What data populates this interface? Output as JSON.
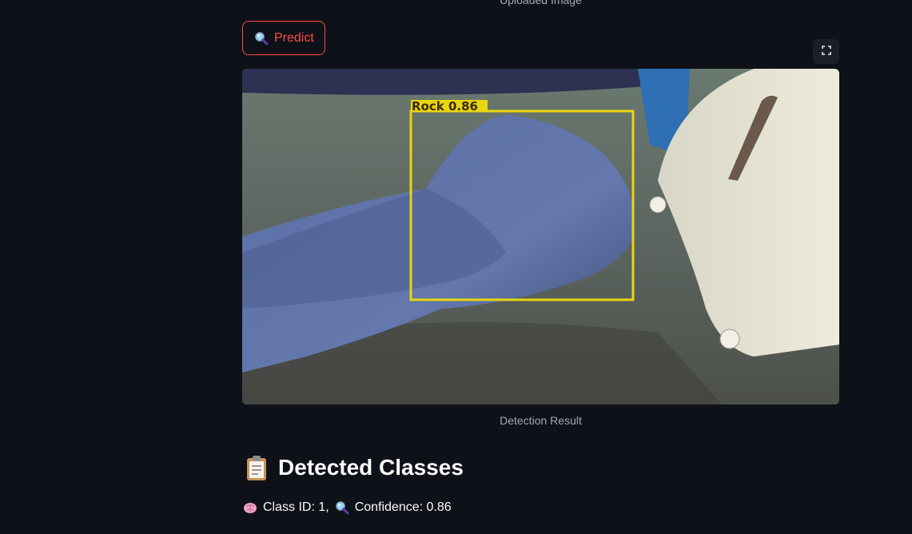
{
  "upload": {
    "caption": "Uploaded Image"
  },
  "predict_button": {
    "label": "Predict",
    "icon": "magnifier-icon"
  },
  "fullscreen_button": {
    "icon": "fullscreen-icon"
  },
  "result": {
    "caption": "Detection Result",
    "box_label": "Rock  0.86",
    "box_color": "#e8d60e"
  },
  "detected_section": {
    "heading": "Detected Classes",
    "icon": "clipboard-icon"
  },
  "detections": [
    {
      "class_icon": "brain-icon",
      "class_text": "Class ID: 1,",
      "confidence_icon": "magnifier-icon",
      "confidence_text": "Confidence: 0.86"
    }
  ],
  "theme": {
    "background": "#0e1117",
    "accent": "#ff4b4b",
    "text": "#fafafa",
    "muted_text": "#a3a8b4"
  }
}
